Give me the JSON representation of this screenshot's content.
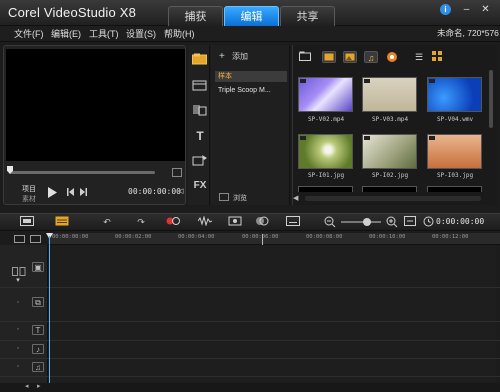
{
  "app": {
    "title": "Corel VideoStudio X8"
  },
  "tabs": [
    {
      "label": "捕获",
      "active": false
    },
    {
      "label": "编辑",
      "active": true
    },
    {
      "label": "共享",
      "active": false
    }
  ],
  "window_controls": {
    "info": "i",
    "minimize": "–",
    "close": "✕"
  },
  "menu": [
    "文件(F)",
    "编辑(E)",
    "工具(T)",
    "设置(S)",
    "帮助(H)"
  ],
  "project_info": "未命名, 720*576",
  "preview": {
    "mode_project": "项目",
    "mode_clip": "素材",
    "timecode": "00:00:00:00"
  },
  "library": {
    "add_label": "添加",
    "items": [
      "样本",
      "Triple Scoop M..."
    ],
    "selected_index": 0,
    "browse_label": "浏览"
  },
  "media": {
    "thumbnails": [
      {
        "name": "SP-V02.mp4",
        "kind": "video"
      },
      {
        "name": "SP-V03.mp4",
        "kind": "video"
      },
      {
        "name": "SP-V04.wmv",
        "kind": "video"
      },
      {
        "name": "SP-I01.jpg",
        "kind": "image"
      },
      {
        "name": "SP-I02.jpg",
        "kind": "image"
      },
      {
        "name": "SP-I03.jpg",
        "kind": "image"
      }
    ]
  },
  "tools": [
    "media-icon",
    "instant-project-icon",
    "transition-icon",
    "title-icon",
    "graphic-icon",
    "filter-icon"
  ],
  "tool_labels": {
    "title": "T",
    "fx": "FX"
  },
  "timeline": {
    "timecode": "0:00:00:00",
    "ruler": [
      "00:00:00:00",
      "00:00:02:00",
      "00:00:04:00",
      "00:00:06:00",
      "00:00:08:00",
      "00:00:10:00",
      "00:00:12:00"
    ]
  },
  "colors": {
    "accent": "#1a8cf0",
    "selection": "#f2b23b",
    "background": "#1c1c1c"
  }
}
